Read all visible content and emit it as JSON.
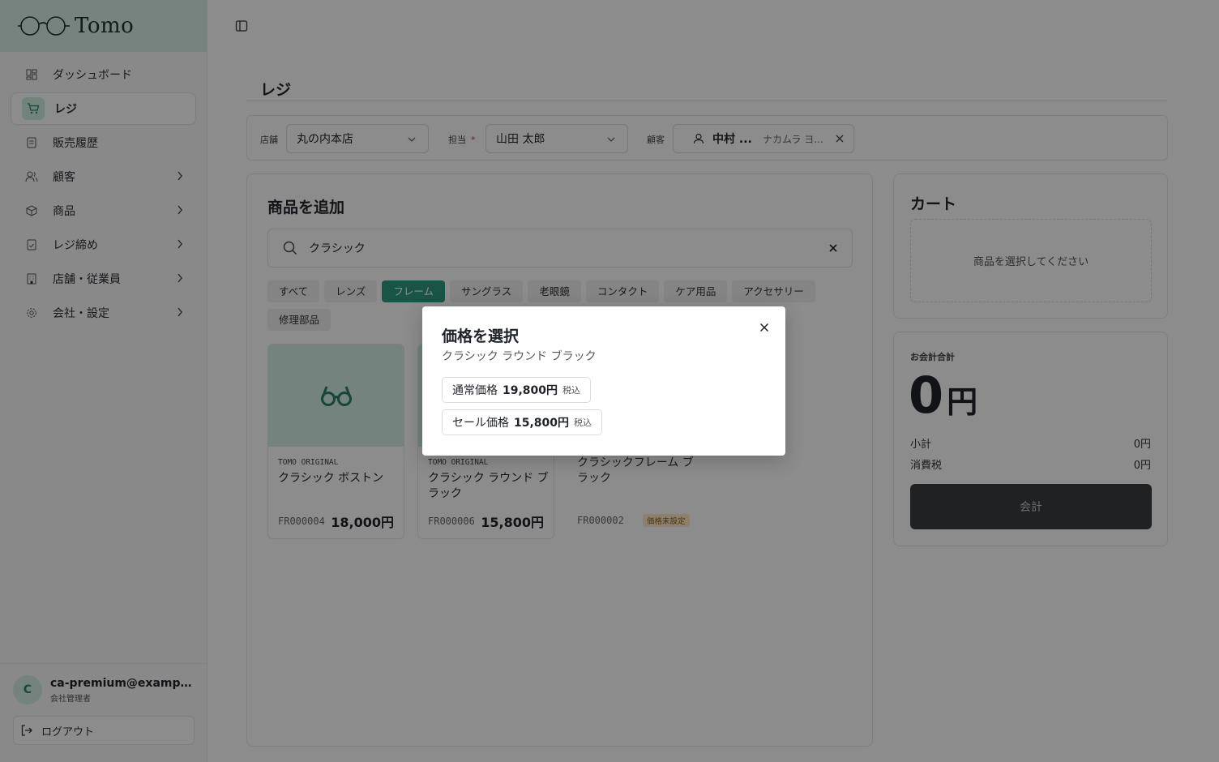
{
  "app": {
    "logo_text": "Tomo"
  },
  "sidebar": {
    "items": [
      {
        "label": "ダッシュボード",
        "icon": "dashboard-icon",
        "has_children": false
      },
      {
        "label": "レジ",
        "icon": "cart-icon",
        "has_children": false,
        "active": true
      },
      {
        "label": "販売履歴",
        "icon": "receipt-icon",
        "has_children": false
      },
      {
        "label": "顧客",
        "icon": "users-icon",
        "has_children": true
      },
      {
        "label": "商品",
        "icon": "package-icon",
        "has_children": true
      },
      {
        "label": "レジ締め",
        "icon": "register-close-icon",
        "has_children": true
      },
      {
        "label": "店舗・従業員",
        "icon": "store-icon",
        "has_children": true
      },
      {
        "label": "会社・設定",
        "icon": "gear-icon",
        "has_children": true
      }
    ],
    "user": {
      "initial": "C",
      "email": "ca-premium@example.com",
      "role": "会社管理者"
    },
    "logout_label": "ログアウト"
  },
  "page": {
    "title": "レジ"
  },
  "filters": {
    "store_label": "店舗",
    "store_value": "丸の内本店",
    "staff_label": "担当",
    "staff_required": "*",
    "staff_value": "山田 太郎",
    "customer_label": "顧客",
    "customer_name": "中村 ...",
    "customer_kana": "ナカムラ ヨ..."
  },
  "add_product": {
    "title": "商品を追加",
    "search_value": "クラシック",
    "categories": [
      "すべて",
      "レンズ",
      "フレーム",
      "サングラス",
      "老眼鏡",
      "コンタクト",
      "ケア用品",
      "アクセサリー",
      "修理部品"
    ],
    "active_category": "フレーム",
    "products": [
      {
        "brand": "TOMO ORIGINAL",
        "name": "クラシック ボストン",
        "code": "FR000004",
        "price": "18,000円"
      },
      {
        "brand": "TOMO ORIGINAL",
        "name": "クラシック ラウンド ブラック",
        "code": "FR000006",
        "price": "15,800円"
      },
      {
        "brand": "",
        "name": "クラシックフレーム ブラック",
        "code": "FR000002",
        "price": "",
        "badge": "価格未設定"
      }
    ]
  },
  "cart": {
    "title": "カート",
    "empty_text": "商品を選択してください"
  },
  "totals": {
    "label": "お会計合計",
    "amount": "0",
    "unit": "円",
    "subtotal_label": "小計",
    "subtotal_value": "0円",
    "tax_label": "消費税",
    "tax_value": "0円",
    "checkout_label": "会計"
  },
  "modal": {
    "title": "価格を選択",
    "subtitle": "クラシック ラウンド ブラック",
    "options": [
      {
        "label": "通常価格",
        "amount": "19,800円",
        "tax_note": "税込"
      },
      {
        "label": "セール価格",
        "amount": "15,800円",
        "tax_note": "税込"
      }
    ]
  },
  "colors": {
    "accent": "#2d9b80",
    "accent_light": "#d4efe6",
    "checkout_disabled": "#3a3d3f"
  }
}
